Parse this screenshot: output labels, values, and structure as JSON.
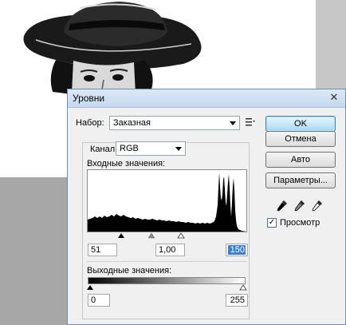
{
  "dialog": {
    "title": "Уровни",
    "close_glyph": "✕",
    "preset_label": "Набор:",
    "preset_value": "Заказная",
    "channel_label": "Канал:",
    "channel_value": "RGB",
    "input_levels_label": "Входные значения:",
    "input_black": "51",
    "input_gamma": "1,00",
    "input_white": "150",
    "output_levels_label": "Выходные значения:",
    "output_black": "0",
    "output_white": "255",
    "buttons": {
      "ok": "OK",
      "cancel": "Отмена",
      "auto": "Авто",
      "options": "Параметры..."
    },
    "preview_label": "Просмотр",
    "preview_checked": true,
    "icons": [
      "preset-menu-icon",
      "black-eyedropper-icon",
      "gray-eyedropper-icon",
      "white-eyedropper-icon",
      "close-icon"
    ]
  },
  "colors": {
    "accent": "#3c7fb1",
    "selection": "#3b80d0",
    "workspace": "#a7a7a7"
  }
}
